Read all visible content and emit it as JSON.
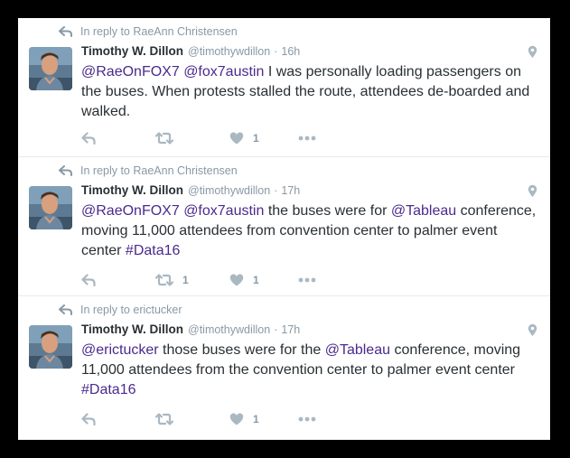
{
  "colors": {
    "background": "#000000",
    "card": "#ffffff",
    "link": "#4b2a8c",
    "muted": "#8899a6",
    "text": "#292f33",
    "divider": "#e6ecf0"
  },
  "tweets": [
    {
      "reply_context": "In reply to RaeAnn Christensen",
      "fullname": "Timothy W. Dillon",
      "handle": "@timothywdillon",
      "dot": "·",
      "time": "16h",
      "segments": [
        {
          "type": "mention",
          "text": "@RaeOnFOX7"
        },
        {
          "type": "text",
          "text": " "
        },
        {
          "type": "mention",
          "text": "@fox7austin"
        },
        {
          "type": "text",
          "text": " I was personally loading passengers on the buses. When protests stalled the route, attendees de-boarded and walked."
        }
      ],
      "retweet_count": "",
      "like_count": "1",
      "icons": {
        "context": "reply-arrow-icon",
        "geo": "location-pin-icon",
        "reply": "reply-icon",
        "retweet": "retweet-icon",
        "like": "heart-icon",
        "more": "more-dots-icon"
      }
    },
    {
      "reply_context": "In reply to RaeAnn Christensen",
      "fullname": "Timothy W. Dillon",
      "handle": "@timothywdillon",
      "dot": "·",
      "time": "17h",
      "segments": [
        {
          "type": "mention",
          "text": "@RaeOnFOX7"
        },
        {
          "type": "text",
          "text": " "
        },
        {
          "type": "mention",
          "text": "@fox7austin"
        },
        {
          "type": "text",
          "text": " the buses were for "
        },
        {
          "type": "mention",
          "text": "@Tableau"
        },
        {
          "type": "text",
          "text": " conference, moving 11,000 attendees from convention center to palmer event center "
        },
        {
          "type": "hashtag",
          "text": "#Data16"
        }
      ],
      "retweet_count": "1",
      "like_count": "1",
      "icons": {
        "context": "reply-arrow-icon",
        "geo": "location-pin-icon",
        "reply": "reply-icon",
        "retweet": "retweet-icon",
        "like": "heart-icon",
        "more": "more-dots-icon"
      }
    },
    {
      "reply_context": "In reply to erictucker",
      "fullname": "Timothy W. Dillon",
      "handle": "@timothywdillon",
      "dot": "·",
      "time": "17h",
      "segments": [
        {
          "type": "mention",
          "text": "@erictucker"
        },
        {
          "type": "text",
          "text": " those buses were for the "
        },
        {
          "type": "mention",
          "text": "@Tableau"
        },
        {
          "type": "text",
          "text": " conference, moving 11,000 attendees from the convention center to palmer event center "
        },
        {
          "type": "hashtag",
          "text": "#Data16"
        }
      ],
      "retweet_count": "",
      "like_count": "1",
      "icons": {
        "context": "reply-arrow-icon",
        "geo": "location-pin-icon",
        "reply": "reply-icon",
        "retweet": "retweet-icon",
        "like": "heart-icon",
        "more": "more-dots-icon"
      }
    }
  ]
}
